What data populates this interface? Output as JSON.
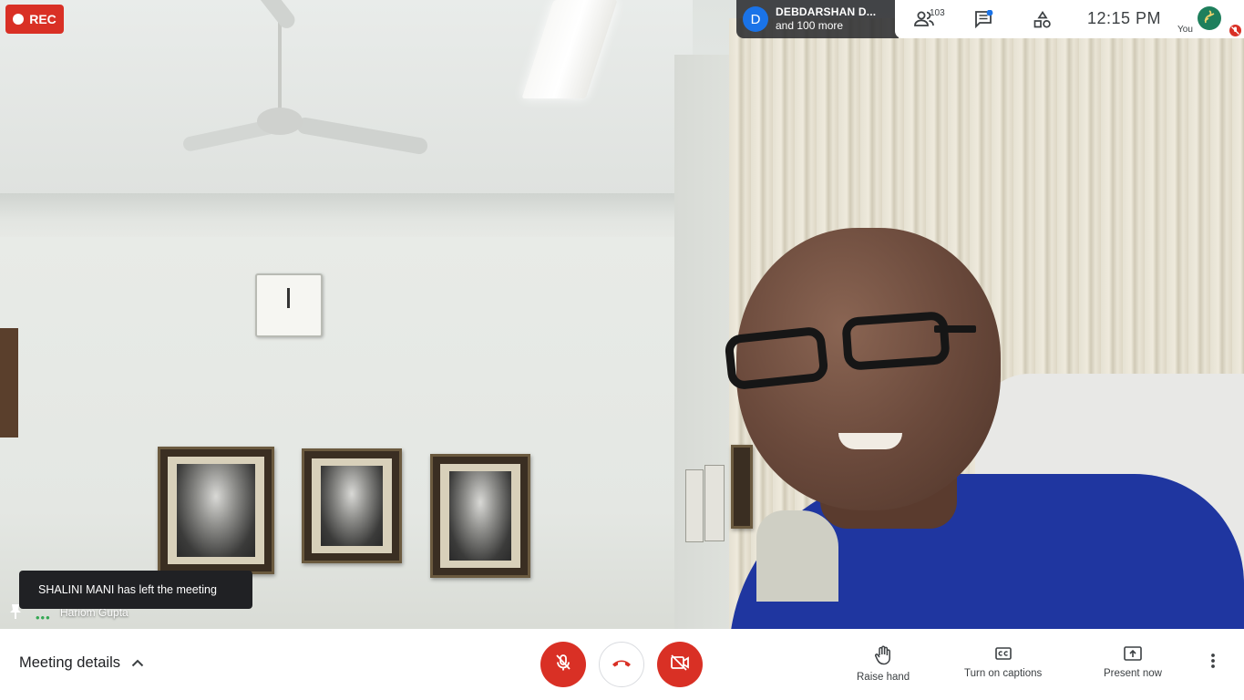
{
  "recording": {
    "label": "REC",
    "color": "#d93025"
  },
  "presenter": {
    "initial": "D",
    "name": "DEBDARSHAN D...",
    "more": "and 100 more",
    "avatar_color": "#1a73e8"
  },
  "topbar": {
    "participants_icon": "people-icon",
    "participant_count": "103",
    "chat_icon": "chat-icon",
    "activities_icon": "shapes-icon",
    "time": "12:15  PM",
    "self_label": "You",
    "self_mic_status_icon": "mic-off-icon"
  },
  "notification": {
    "text": "SHALINI MANI has left the meeting"
  },
  "speaker": {
    "name": "Hariom Gupta",
    "pin_icon": "pin-icon"
  },
  "bottombar": {
    "meeting_details_label": "Meeting details",
    "mic_icon": "mic-off-icon",
    "hangup_icon": "hang-up-icon",
    "camera_icon": "camera-off-icon",
    "raise_hand_label": "Raise hand",
    "captions_label": "Turn on captions",
    "present_label": "Present now",
    "more_icon": "more-vertical-icon"
  },
  "colors": {
    "accent_red": "#d93025",
    "brand_blue": "#1a73e8",
    "text_dark": "#3c4043"
  }
}
